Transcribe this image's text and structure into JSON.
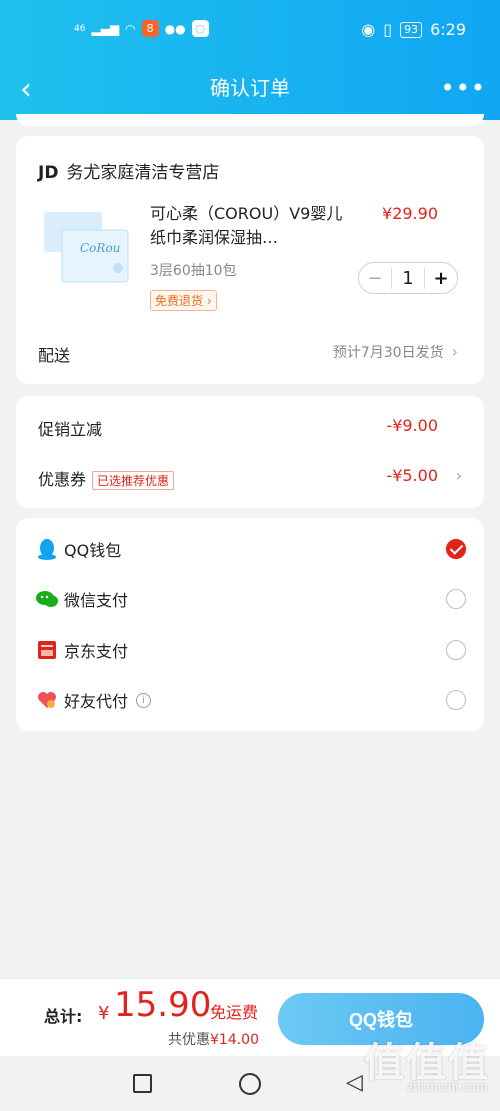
{
  "status_bar": {
    "signal": "46",
    "battery": "93",
    "time": "6:29"
  },
  "nav": {
    "title": "确认订单",
    "more": "•••"
  },
  "shop": {
    "brand": "JD",
    "name": "务尤家庭清洁专营店"
  },
  "product": {
    "title": "可心柔（COROU）V9婴儿纸巾柔润保湿抽…",
    "price": "¥29.90",
    "spec": "3层60抽10包",
    "return_tag": "免费退货 ›",
    "quantity": "1",
    "minus": "−",
    "plus": "+",
    "thumb_brand": "CoRou"
  },
  "delivery": {
    "label": "配送",
    "value": "预计7月30日发货"
  },
  "discounts": {
    "promo_label": "促销立减",
    "promo_value": "-¥9.00",
    "coupon_label": "优惠券",
    "coupon_badge": "已选推荐优惠",
    "coupon_value": "-¥5.00"
  },
  "payments": [
    {
      "label": "QQ钱包",
      "icon": "qq-penguin-icon",
      "selected": true
    },
    {
      "label": "微信支付",
      "icon": "wechat-icon",
      "selected": false
    },
    {
      "label": "京东支付",
      "icon": "jd-pay-icon",
      "selected": false
    },
    {
      "label": "好友代付",
      "icon": "friend-pay-icon",
      "selected": false
    }
  ],
  "footer": {
    "total_label": "总计:",
    "currency": "¥",
    "total": "15.90",
    "free_shipping": "免运费",
    "saved_prefix": "共优惠",
    "saved_amount": "¥14.00",
    "pay_button": "QQ钱包"
  },
  "watermark": {
    "text": "值值值",
    "sub": "zhizhizhi.com"
  },
  "colors": {
    "accent": "#11a6f3",
    "price_red": "#e2231a"
  }
}
